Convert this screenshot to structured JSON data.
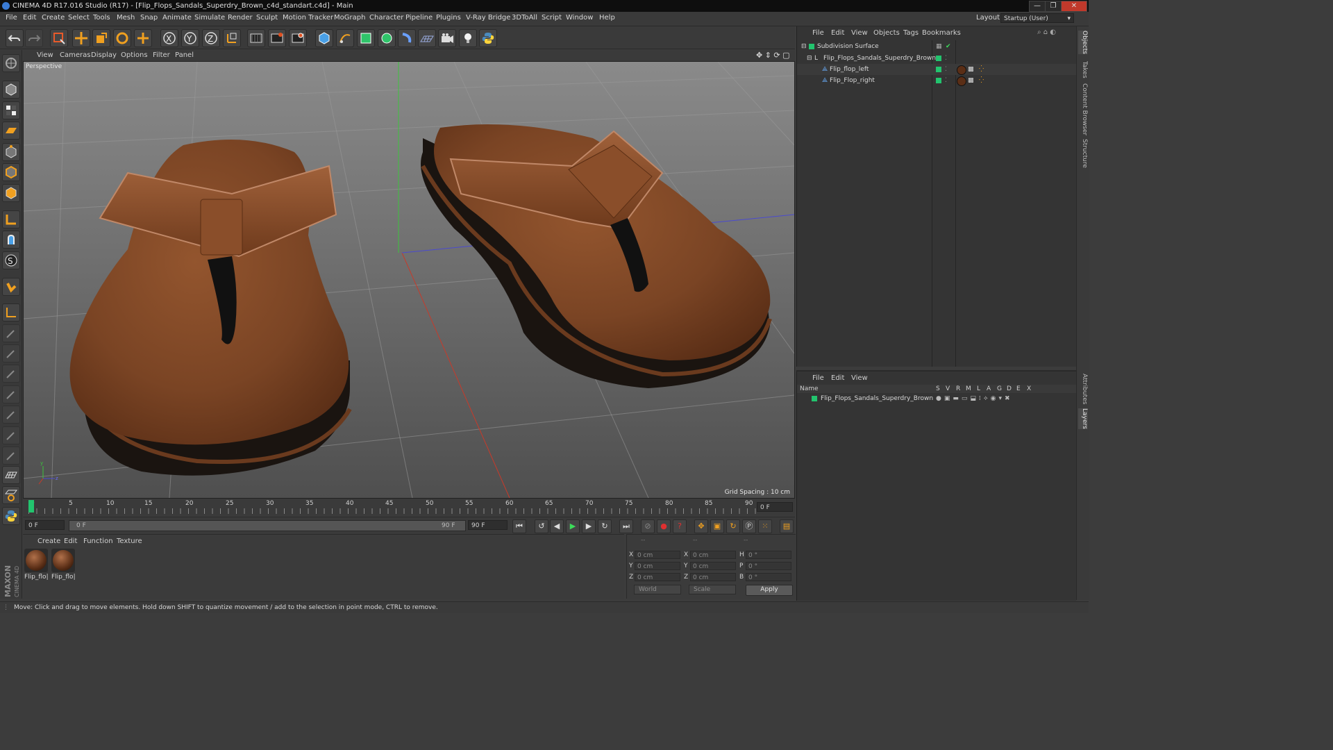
{
  "window": {
    "title": "CINEMA 4D R17.016 Studio (R17) - [Flip_Flops_Sandals_Superdry_Brown_c4d_standart.c4d] - Main",
    "controls": [
      "—",
      "❐",
      "✕"
    ]
  },
  "menubar": {
    "items": [
      "File",
      "Edit",
      "Create",
      "Select",
      "Tools",
      "Mesh",
      "Snap",
      "Animate",
      "Simulate",
      "Render",
      "Sculpt",
      "Motion Tracker",
      "MoGraph",
      "Character",
      "Pipeline",
      "Plugins",
      "V-Ray Bridge",
      "3DToAll",
      "Script",
      "Window",
      "Help"
    ],
    "layout_label": "Layout:",
    "layout_value": "Startup (User)"
  },
  "viewport": {
    "menu": [
      "View",
      "Cameras",
      "Display",
      "Options",
      "Filter",
      "Panel"
    ],
    "camera_label": "Perspective",
    "grid_spacing": "Grid Spacing : 10 cm"
  },
  "timeline": {
    "ticks": [
      "0",
      "5",
      "10",
      "15",
      "20",
      "25",
      "30",
      "35",
      "40",
      "45",
      "50",
      "55",
      "60",
      "65",
      "70",
      "75",
      "80",
      "85",
      "90"
    ],
    "current_frame": "0 F",
    "start_field": "0 F",
    "range_start": "0 F",
    "range_end": "90 F",
    "end_field": "90 F"
  },
  "material_manager": {
    "menu": [
      "Create",
      "Edit",
      "Function",
      "Texture"
    ],
    "materials": [
      "Flip_flo|",
      "Flip_flo|"
    ]
  },
  "coordinates": {
    "header_dashes": [
      "--",
      "--",
      "--"
    ],
    "rows": [
      {
        "l1": "X",
        "v1": "0 cm",
        "l2": "X",
        "v2": "0 cm",
        "l3": "H",
        "v3": "0 °"
      },
      {
        "l1": "Y",
        "v1": "0 cm",
        "l2": "Y",
        "v2": "0 cm",
        "l3": "P",
        "v3": "0 °"
      },
      {
        "l1": "Z",
        "v1": "0 cm",
        "l2": "Z",
        "v2": "0 cm",
        "l3": "B",
        "v3": "0 °"
      }
    ],
    "world": "World",
    "scale": "Scale",
    "apply": "Apply"
  },
  "object_manager": {
    "menu": [
      "File",
      "Edit",
      "View",
      "Objects",
      "Tags",
      "Bookmarks"
    ],
    "objects": [
      "Subdivision Surface",
      "Flip_Flops_Sandals_Superdry_Brown",
      "Flip_flop_left",
      "Flip_Flop_right"
    ]
  },
  "layer_manager": {
    "menu": [
      "File",
      "Edit",
      "View"
    ],
    "name_header": "Name",
    "columns": [
      "S",
      "V",
      "R",
      "M",
      "L",
      "A",
      "G",
      "D",
      "E",
      "X"
    ],
    "layer": "Flip_Flops_Sandals_Superdry_Brown"
  },
  "right_tabs": [
    "Objects",
    "Takes",
    "Content Browser",
    "Structure",
    "Attributes",
    "Layers"
  ],
  "branding": {
    "maxon": "MAXON",
    "product": "CINEMA 4D"
  },
  "status": "Move: Click and drag to move elements. Hold down SHIFT to quantize movement / add to the selection in point mode, CTRL to remove.",
  "colors": {
    "accent_green": "#22c46e",
    "leather": "#7a4424",
    "axis_red": "#c83a2a",
    "axis_green": "#3cc43c",
    "axis_blue": "#4a4ad0"
  }
}
